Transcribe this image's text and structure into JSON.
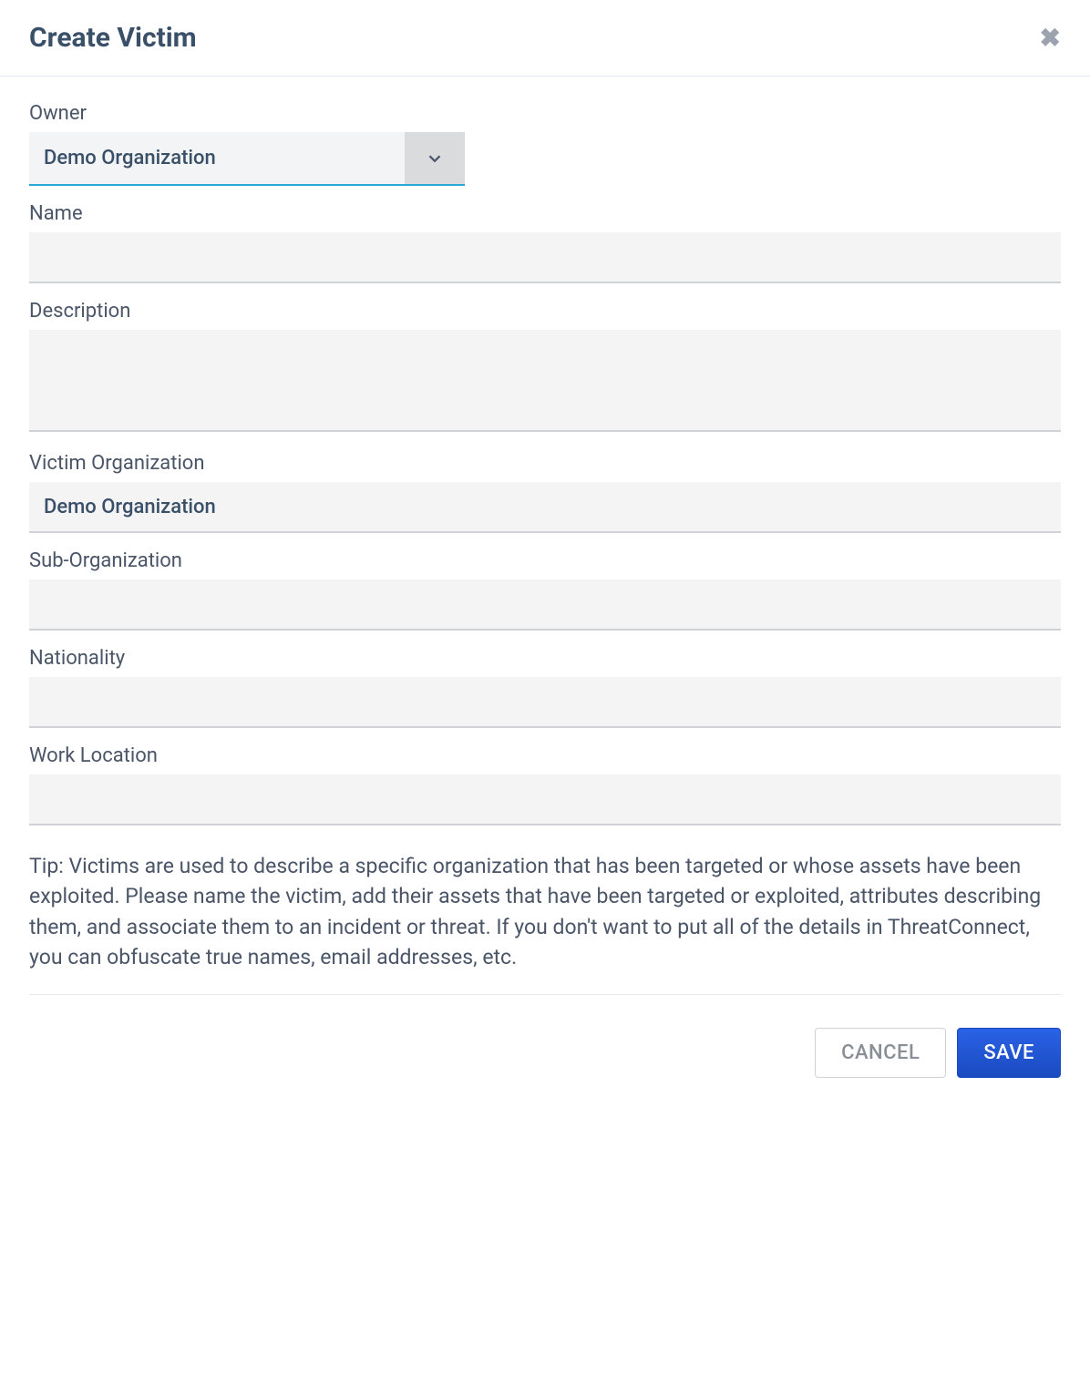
{
  "modal": {
    "title": "Create Victim"
  },
  "form": {
    "owner": {
      "label": "Owner",
      "value": "Demo Organization"
    },
    "name": {
      "label": "Name",
      "value": ""
    },
    "description": {
      "label": "Description",
      "value": ""
    },
    "victim_org": {
      "label": "Victim Organization",
      "value": "Demo Organization"
    },
    "sub_org": {
      "label": "Sub-Organization",
      "value": ""
    },
    "nationality": {
      "label": "Nationality",
      "value": ""
    },
    "work_location": {
      "label": "Work Location",
      "value": ""
    }
  },
  "tip": "Tip: Victims are used to describe a specific organization that has been targeted or whose assets have been exploited. Please name the victim, add their assets that have been targeted or exploited, attributes describing them, and associate them to an incident or threat. If you don't want to put all of the details in ThreatConnect, you can obfuscate true names, email addresses, etc.",
  "buttons": {
    "cancel": "CANCEL",
    "save": "SAVE"
  }
}
